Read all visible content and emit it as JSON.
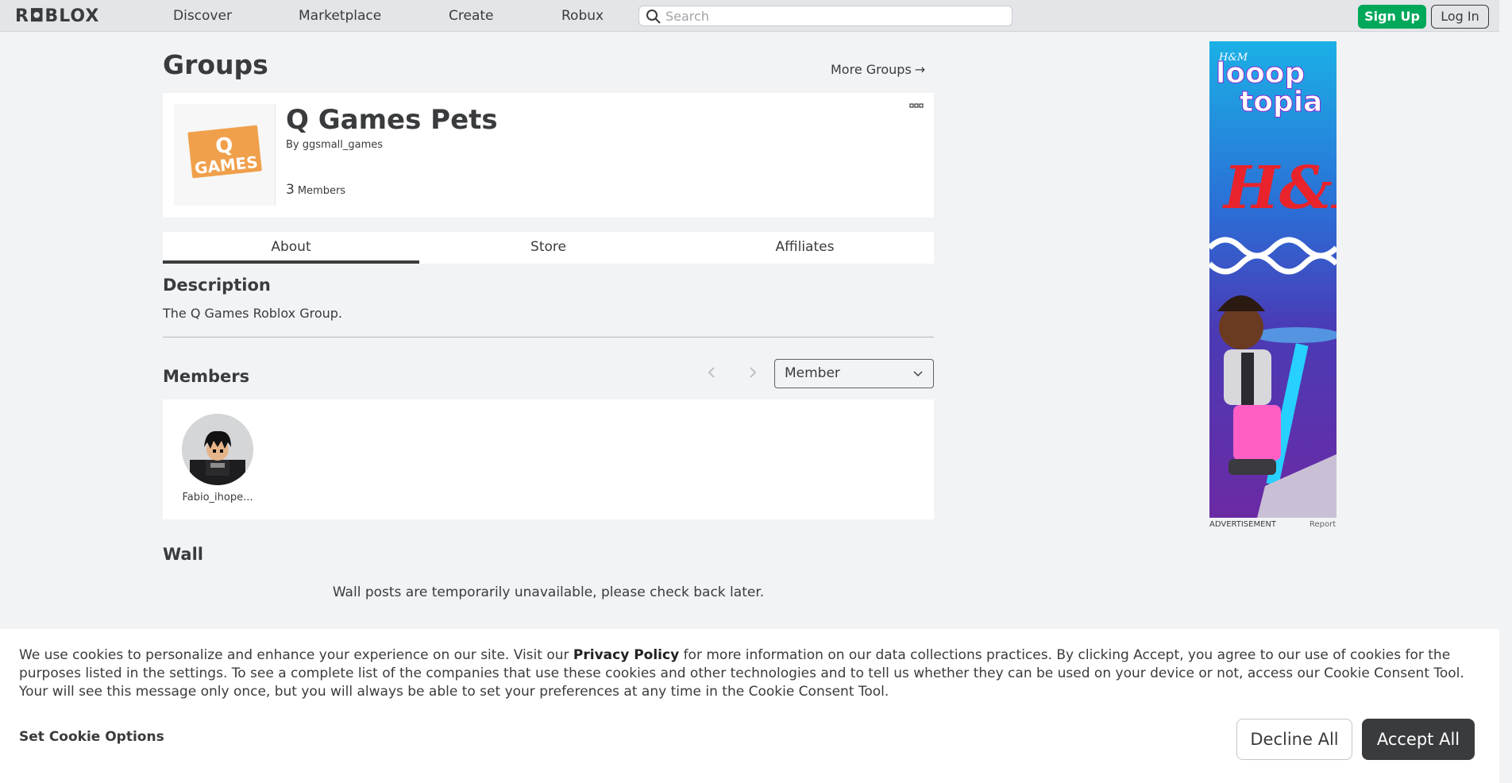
{
  "nav": {
    "logo": "R◘BLOX",
    "links": [
      "Discover",
      "Marketplace",
      "Create",
      "Robux"
    ],
    "search_placeholder": "Search",
    "signup": "Sign Up",
    "login": "Log In"
  },
  "page": {
    "title": "Groups",
    "more_groups": "More Groups",
    "more_groups_arrow": "→"
  },
  "group": {
    "name": "Q Games Pets",
    "by_prefix": "By",
    "owner": "ggsmall_games",
    "member_count": "3",
    "members_label": "Members",
    "options_icon": "ellipsis-icon",
    "logo_letter": "Q",
    "logo_word": "GAMES",
    "logo_color": "#f0a04b"
  },
  "tabs": [
    "About",
    "Store",
    "Affiliates"
  ],
  "about": {
    "description_title": "Description",
    "description": "The Q Games Roblox Group.",
    "members_title": "Members",
    "role_selected": "Member",
    "members": [
      {
        "name": "Fabio_ihope..."
      }
    ],
    "wall_title": "Wall",
    "wall_message": "Wall posts are temporarily unavailable, please check back later."
  },
  "ad": {
    "caption": "ADVERTISEMENT",
    "report": "Report",
    "brand_small": "H&M",
    "headline1": "looop",
    "headline2": "topia",
    "brand_big": "H&M"
  },
  "cookie": {
    "text_part1": "We use cookies to personalize and enhance your experience on our site. Visit our ",
    "privacy_link": "Privacy Policy",
    "text_part2": " for more information on our data collections practices. By clicking Accept, you agree to our use of cookies for the purposes listed in the settings. To see a complete list of the companies that use these cookies and other technologies and to tell us whether they can be used on your device or not, access our Cookie Consent Tool. Your will see this message only once, but you will always be able to set your preferences at any time in the Cookie Consent Tool.",
    "set_options": "Set Cookie Options",
    "decline": "Decline All",
    "accept": "Accept All"
  },
  "colors": {
    "signup_green": "#00a85a",
    "text_dark": "#393b3d",
    "background": "#f2f3f4"
  }
}
